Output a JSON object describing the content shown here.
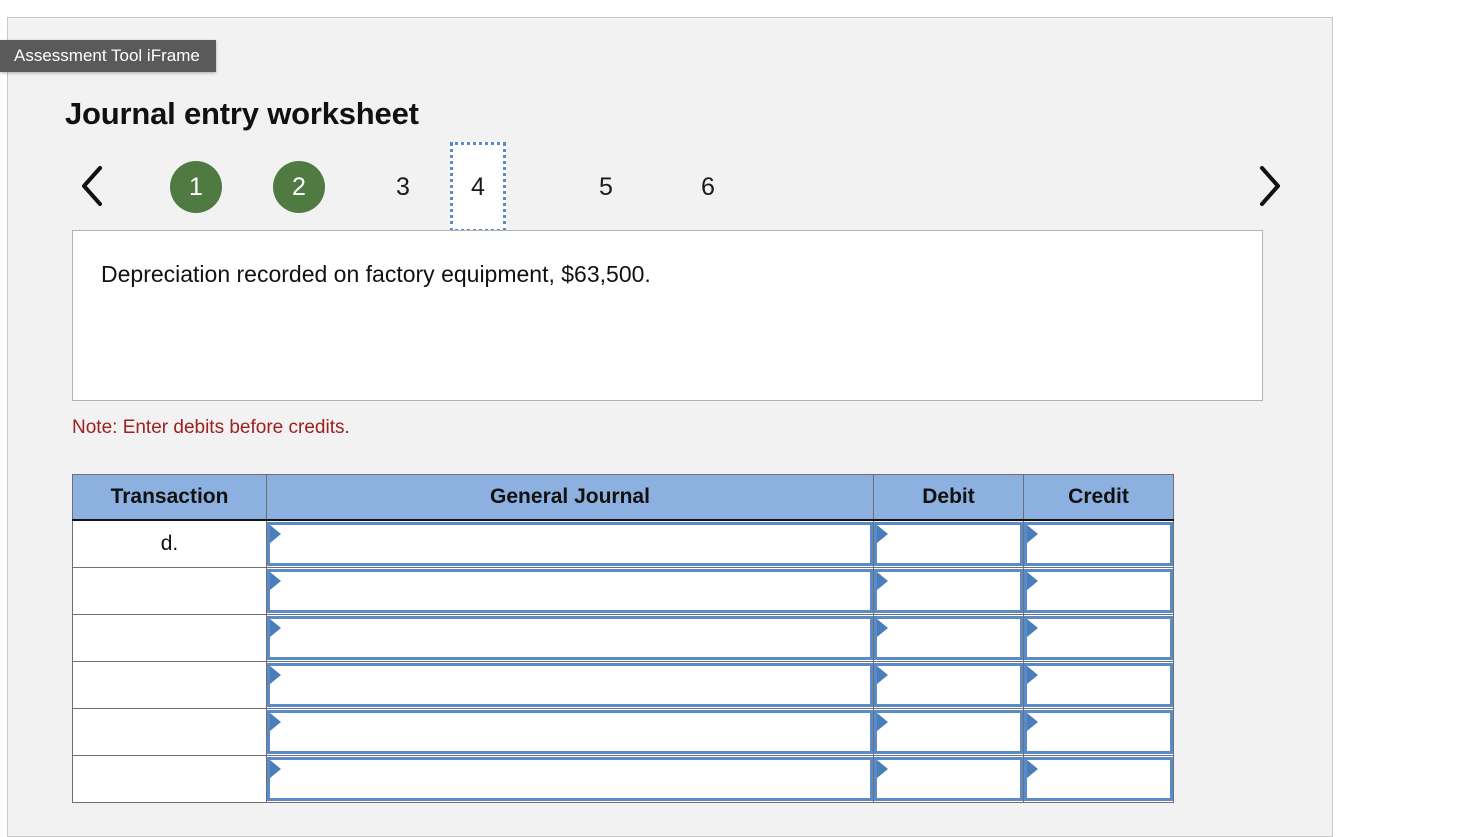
{
  "tooltip": {
    "label": "Assessment Tool iFrame"
  },
  "page": {
    "title": "Journal entry worksheet",
    "note": "Note: Enter debits before credits."
  },
  "pager": {
    "prev_icon": "chevron-left-icon",
    "next_icon": "chevron-right-icon",
    "items": [
      {
        "label": "1",
        "state": "done"
      },
      {
        "label": "2",
        "state": "done"
      },
      {
        "label": "3",
        "state": "normal"
      },
      {
        "label": "4",
        "state": "current"
      },
      {
        "label": "5",
        "state": "normal"
      },
      {
        "label": "6",
        "state": "normal"
      }
    ]
  },
  "statement": {
    "text": "Depreciation recorded on factory equipment, $63,500."
  },
  "table": {
    "headers": [
      "Transaction",
      "General Journal",
      "Debit",
      "Credit"
    ],
    "rows": [
      {
        "transaction": "d.",
        "general_journal": "",
        "debit": "",
        "credit": ""
      },
      {
        "transaction": "",
        "general_journal": "",
        "debit": "",
        "credit": ""
      },
      {
        "transaction": "",
        "general_journal": "",
        "debit": "",
        "credit": ""
      },
      {
        "transaction": "",
        "general_journal": "",
        "debit": "",
        "credit": ""
      },
      {
        "transaction": "",
        "general_journal": "",
        "debit": "",
        "credit": ""
      },
      {
        "transaction": "",
        "general_journal": "",
        "debit": "",
        "credit": ""
      }
    ]
  },
  "colors": {
    "header_blue": "#8cb1e0",
    "field_blue": "#5b8ac8",
    "done_green": "#4f7a41",
    "note_red": "#9e2020",
    "tooltip_gray": "#5a5a5a"
  }
}
